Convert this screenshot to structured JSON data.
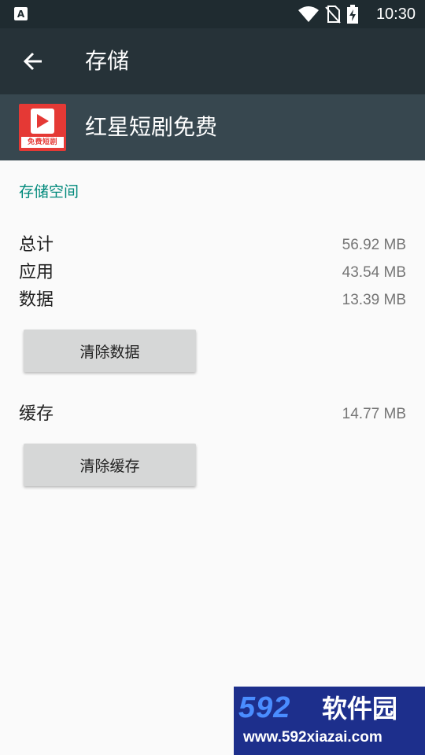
{
  "status_bar": {
    "notification_glyph": "A",
    "time": "10:30",
    "icons": [
      "wifi-icon",
      "no-sim-icon",
      "battery-charging-icon"
    ]
  },
  "app_bar": {
    "title": "存储",
    "back_icon": "arrow-left-icon"
  },
  "app_header": {
    "name": "红星短剧免费",
    "icon_tag": "免费短剧",
    "icon_color": "#e53935"
  },
  "storage": {
    "section_title": "存储空间",
    "rows": [
      {
        "label": "总计",
        "value": "56.92 MB"
      },
      {
        "label": "应用",
        "value": "43.54 MB"
      },
      {
        "label": "数据",
        "value": "13.39 MB"
      }
    ],
    "clear_data_label": "清除数据",
    "cache": {
      "label": "缓存",
      "value": "14.77 MB"
    },
    "clear_cache_label": "清除缓存"
  },
  "watermark": {
    "number": "592",
    "chinese": "软件园",
    "url": "www.592xiazai.com"
  },
  "colors": {
    "status_bar": "#1f2b30",
    "app_bar": "#263238",
    "app_header": "#37474f",
    "accent": "#00897b",
    "background": "#fafafa"
  }
}
